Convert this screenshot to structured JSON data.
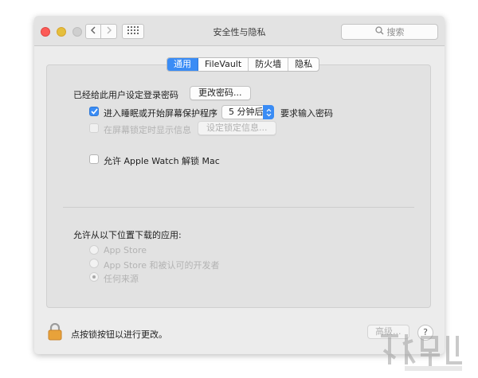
{
  "window": {
    "title": "安全性与隐私",
    "search_placeholder": "搜索",
    "icons": [
      "close-light",
      "minimize-light",
      "zoom-light",
      "chevron-left-icon",
      "chevron-right-icon",
      "grid-icon",
      "search-icon"
    ]
  },
  "tabs": [
    {
      "label": "通用",
      "active": true
    },
    {
      "label": "FileVault",
      "active": false
    },
    {
      "label": "防火墙",
      "active": false
    },
    {
      "label": "隐私",
      "active": false
    }
  ],
  "general": {
    "password_label": "已经给此用户设定登录密码",
    "change_password_button": "更改密码...",
    "sleep_checkbox_label": "进入睡眠或开始屏幕保护程序",
    "sleep_checked": true,
    "delay_value": "5 分钟后",
    "require_password_label": "要求输入密码",
    "lock_message_label": "在屏幕锁定时显示信息",
    "lock_message_checked": false,
    "set_lock_message_button": "设定锁定信息...",
    "apple_watch_label": "允许 Apple Watch 解锁 Mac",
    "apple_watch_checked": false
  },
  "downloads": {
    "heading": "允许从以下位置下载的应用:",
    "options": [
      {
        "label": "App Store",
        "selected": false
      },
      {
        "label": "App Store 和被认可的开发者",
        "selected": false
      },
      {
        "label": "任何来源",
        "selected": true
      }
    ]
  },
  "footer": {
    "lock_text": "点按锁按钮以进行更改。",
    "advanced_button": "高级...",
    "help_button": "?"
  },
  "colors": {
    "accent": "#3a8cf5",
    "window_bg": "#ececec",
    "panel_bg": "#e2e2e2",
    "close": "#fc5b57",
    "minimize": "#e5bf3c"
  }
}
